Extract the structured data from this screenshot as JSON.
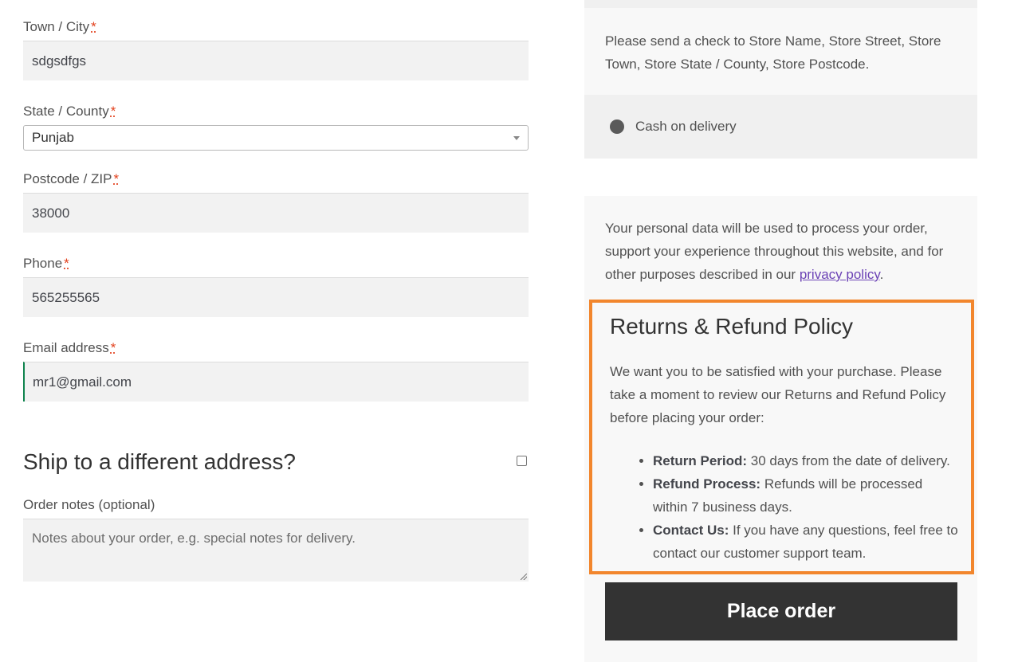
{
  "billing": {
    "town": {
      "label": "Town / City",
      "required": "*",
      "value": "sdgsdfgs"
    },
    "state": {
      "label": "State / County",
      "required": "*",
      "value": "Punjab"
    },
    "postcode": {
      "label": "Postcode / ZIP",
      "required": "*",
      "value": "38000"
    },
    "phone": {
      "label": "Phone",
      "required": "*",
      "value": "565255565"
    },
    "email": {
      "label": "Email address",
      "required": "*",
      "value": "mr1@gmail.com"
    }
  },
  "shipping": {
    "title": "Ship to a different address?"
  },
  "order_notes": {
    "label": "Order notes (optional)",
    "placeholder": "Notes about your order, e.g. special notes for delivery."
  },
  "payment": {
    "check_description": "Please send a check to Store Name, Store Street, Store Town, Store State / County, Store Postcode.",
    "cod_label": "Cash on delivery"
  },
  "privacy": {
    "text": "Your personal data will be used to process your order, support your experience throughout this website, and for other purposes described in our ",
    "link_label": "privacy policy",
    "suffix": "."
  },
  "policy": {
    "title": "Returns & Refund Policy",
    "intro": "We want you to be satisfied with your purchase. Please take a moment to review our Returns and Refund Policy before placing your order:",
    "items": [
      {
        "term": "Return Period:",
        "text": " 30 days from the date of delivery."
      },
      {
        "term": "Refund Process:",
        "text": " Refunds will be processed within 7 business days."
      },
      {
        "term": "Contact Us:",
        "text": " If you have any questions, feel free to contact our customer support team."
      }
    ]
  },
  "place_order_label": "Place order",
  "colors": {
    "highlight_border": "#f2862d",
    "button_bg": "#333333",
    "link": "#6b42b5",
    "focus": "#0f834d"
  }
}
